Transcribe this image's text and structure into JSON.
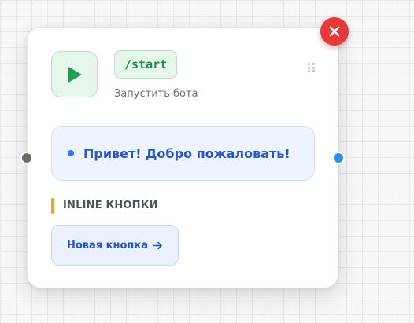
{
  "node": {
    "command": "/start",
    "subtitle": "Запустить бота",
    "message": "Привет! Добро пожаловать!",
    "section_title": "INLINE КНОПКИ",
    "buttons": [
      {
        "label": "Новая кнопка"
      }
    ]
  },
  "icons": {
    "close": "close-icon",
    "start": "play-icon",
    "drag": "drag-handle-icon",
    "button_arrow": "arrow-right-icon"
  },
  "colors": {
    "close": "#e43a38",
    "start_accent": "#1f9d55",
    "start_bg": "#e6f6ea",
    "message_bg": "#eef4fd",
    "message_text": "#2856c9",
    "section_accent": "#f0a823",
    "port_in": "#6f6a66",
    "port_out": "#2a8ff0"
  }
}
